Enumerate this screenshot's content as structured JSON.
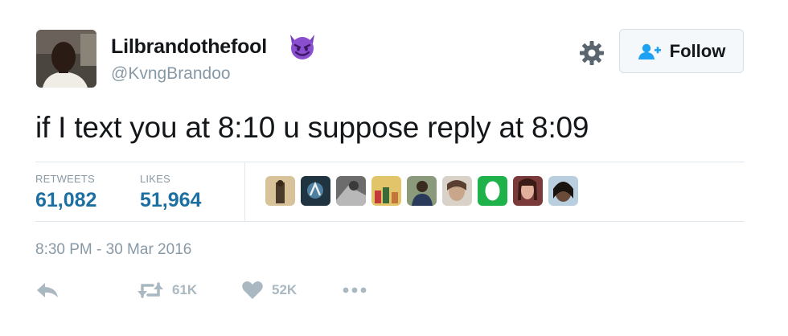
{
  "tweet": {
    "display_name": "Lilbrandothefool",
    "handle": "@KvngBrandoo",
    "text": "if I text you at 8:10 u suppose reply at 8:09",
    "follow_label": "Follow",
    "timestamp": "8:30 PM - 30 Mar 2016"
  },
  "stats": {
    "retweets_label": "RETWEETS",
    "retweets_value": "61,082",
    "likes_label": "LIKES",
    "likes_value": "51,964"
  },
  "actions": {
    "retweet_count": "61K",
    "like_count": "52K"
  },
  "likers": [
    "liker-avatar",
    "liker-avatar",
    "liker-avatar",
    "liker-avatar",
    "liker-avatar",
    "liker-avatar",
    "liker-avatar",
    "liker-avatar",
    "liker-avatar"
  ],
  "icons": [
    "devil-emoji",
    "gear-icon",
    "follow-person-icon",
    "reply-icon",
    "retweet-icon",
    "heart-icon",
    "more-icon"
  ],
  "colors": {
    "accent": "#1b6fa1",
    "muted": "#8899a6",
    "action_gray": "#aab8c2",
    "emoji_purple": "#8a4fcf"
  }
}
